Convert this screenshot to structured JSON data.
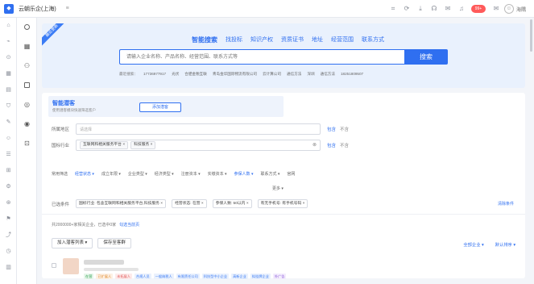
{
  "topbar": {
    "company": "云朝乐企(上海)",
    "badge": "99+",
    "user": "海隅"
  },
  "hero": {
    "corner_label": "最近更新",
    "tabs": [
      "智能搜索",
      "找投标",
      "知识产权",
      "资质证书",
      "地址",
      "经营范围",
      "联系方式"
    ],
    "search_placeholder": "请输入企业名称、产品名称、经营范围、联系方式等",
    "search_button": "搜索",
    "recent_label": "最近搜索：",
    "recent": [
      "17736977917",
      "光伏",
      "合肥金税互联",
      "青岛金华国际物流有限公司",
      "云计算公司",
      "通信方法",
      "深圳",
      "通信方法",
      "18251809507"
    ]
  },
  "smart": {
    "title": "智能潜客",
    "desc": "使用潜客模块快速筛选客户",
    "add": "添加潜客"
  },
  "filters": {
    "region_label": "所属地区",
    "region_placeholder": "请选择",
    "industry_label": "国标行业",
    "industry_tags": [
      "互联网和相关服务平台",
      "科技服务"
    ],
    "include": "包含",
    "exclude": "不含",
    "common_label": "常用筛选",
    "common": [
      "经营状态",
      "成立年限",
      "企业类型",
      "经济类型",
      "注册资本",
      "实缴资本",
      "参保人数",
      "联系方式",
      "官网"
    ],
    "more": "更多"
  },
  "chosen": {
    "label": "已选条件",
    "chips": [
      "国标行业: 包含互联网和相关服务平台,科技服务",
      "经营状态: 在营",
      "参保人数: 50以内",
      "有无手机号: 有手机号码"
    ],
    "clear": "清除条件"
  },
  "results": {
    "count_text": "共2000000+家相关企业，已选中0家",
    "select_page": "勾选当前页",
    "add_list": "加入潜客列表",
    "save_group": "保存至客群",
    "all_companies": "全部企业",
    "default_sort": "默认排序",
    "tags": [
      "在营",
      "已扩展人",
      "未拓展人",
      "合规人员",
      "一般纳税人",
      "有限责任公司",
      "科技型中小企业",
      "高新企业",
      "拟挂牌企业",
      "外广告"
    ]
  },
  "colors": {
    "accent": "#2f6ff0",
    "hero_bg": "#e9f1fd"
  }
}
